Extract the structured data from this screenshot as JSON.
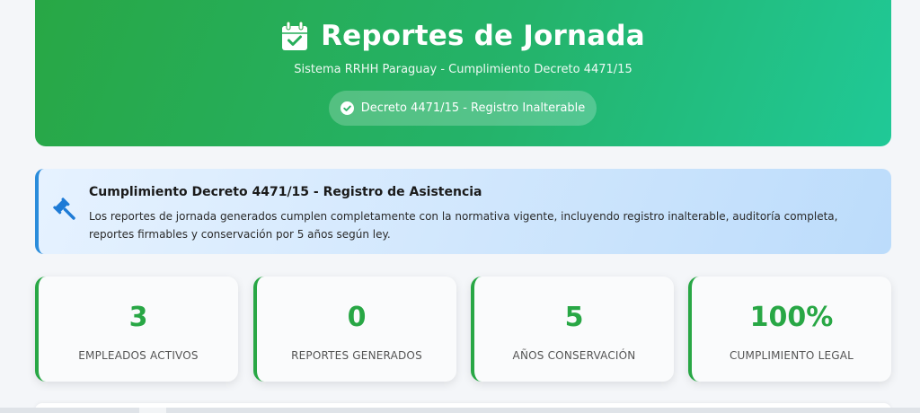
{
  "header": {
    "title": "Reportes de Jornada",
    "subtitle": "Sistema RRHH Paraguay - Cumplimiento Decreto 4471/15",
    "badge": "Decreto 4471/15 - Registro Inalterable",
    "title_icon": "calendar-check-icon",
    "badge_icon": "check-circle-icon"
  },
  "compliance_alert": {
    "icon": "gavel-icon",
    "title": "Cumplimiento Decreto 4471/15 - Registro de Asistencia",
    "text": "Los reportes de jornada generados cumplen completamente con la normativa vigente, incluyendo registro inalterable, auditoría completa, reportes firmables y conservación por 5 años según ley."
  },
  "stats": [
    {
      "value": "3",
      "label": "EMPLEADOS ACTIVOS"
    },
    {
      "value": "0",
      "label": "REPORTES GENERADOS"
    },
    {
      "value": "5",
      "label": "AÑOS CONSERVACIÓN"
    },
    {
      "value": "100%",
      "label": "CUMPLIMIENTO LEGAL"
    }
  ],
  "colors": {
    "accent": "#28a745",
    "hero_gradient_end": "#20c997",
    "alert_border": "#2a8cdb",
    "alert_icon": "#1e7bd6"
  }
}
